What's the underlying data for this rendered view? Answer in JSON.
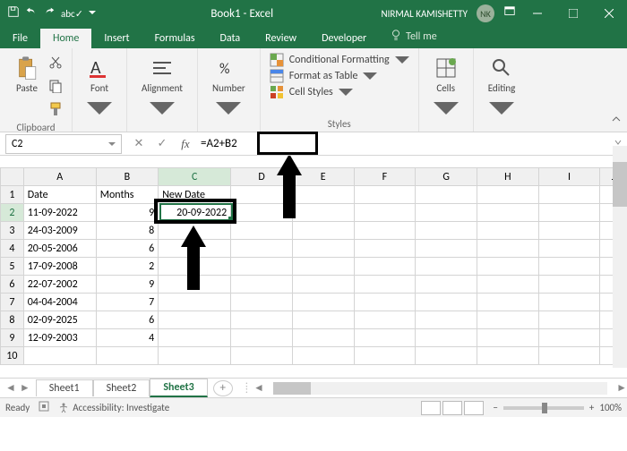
{
  "title": "Book1 - Excel",
  "user": {
    "name": "NIRMAL KAMISHETTY",
    "initials": "NK"
  },
  "tabs": [
    "File",
    "Home",
    "Insert",
    "Formulas",
    "Data",
    "Review",
    "Developer"
  ],
  "active_tab": "Home",
  "tellme": "Tell me",
  "ribbon": {
    "clipboard": {
      "paste": "Paste",
      "label": "Clipboard"
    },
    "font": {
      "btn": "Font"
    },
    "alignment": {
      "btn": "Alignment"
    },
    "number": {
      "btn": "Number"
    },
    "styles": {
      "cond": "Conditional Formatting",
      "table": "Format as Table",
      "cell": "Cell Styles",
      "label": "Styles"
    },
    "cells": {
      "btn": "Cells"
    },
    "editing": {
      "btn": "Editing"
    }
  },
  "namebox": "C2",
  "formula": "=A2+B2",
  "columns": [
    "A",
    "B",
    "C",
    "D",
    "E",
    "F",
    "G",
    "H",
    "I",
    "J"
  ],
  "rows": [
    "1",
    "2",
    "3",
    "4",
    "5",
    "6",
    "7",
    "8",
    "9",
    "10"
  ],
  "data": {
    "headers": [
      "Date",
      "Months",
      "New Date"
    ],
    "body": [
      {
        "date": "11-09-2022",
        "months": "9",
        "newdate": "20-09-2022"
      },
      {
        "date": "24-03-2009",
        "months": "8",
        "newdate": ""
      },
      {
        "date": "20-05-2006",
        "months": "6",
        "newdate": ""
      },
      {
        "date": "17-09-2008",
        "months": "2",
        "newdate": ""
      },
      {
        "date": "22-07-2002",
        "months": "9",
        "newdate": ""
      },
      {
        "date": "04-04-2004",
        "months": "7",
        "newdate": ""
      },
      {
        "date": "02-09-2025",
        "months": "6",
        "newdate": ""
      },
      {
        "date": "12-09-2003",
        "months": "4",
        "newdate": ""
      }
    ]
  },
  "sheets": [
    "Sheet1",
    "Sheet2",
    "Sheet3"
  ],
  "active_sheet": "Sheet3",
  "status": {
    "ready": "Ready",
    "access": "Accessibility: Investigate",
    "zoom": "100%"
  }
}
